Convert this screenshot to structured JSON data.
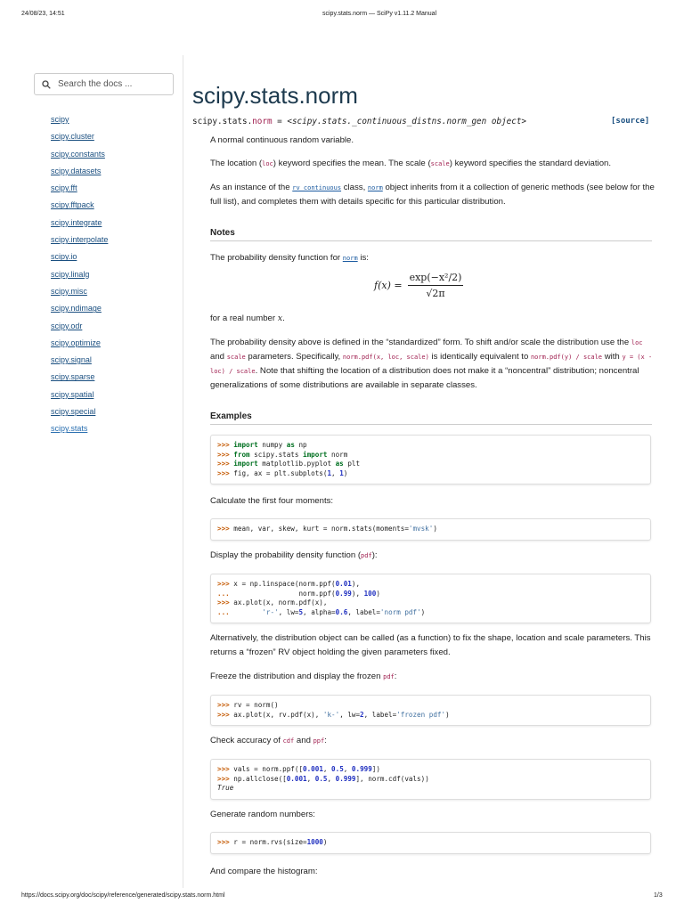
{
  "browser": {
    "datetime": "24/08/23, 14:51",
    "title": "scipy.stats.norm — SciPy v1.11.2 Manual",
    "url": "https://docs.scipy.org/doc/scipy/reference/generated/scipy.stats.norm.html",
    "page": "1/3"
  },
  "search": {
    "placeholder": "Search the docs ..."
  },
  "nav": [
    "scipy",
    "scipy.cluster",
    "scipy.constants",
    "scipy.datasets",
    "scipy.fft",
    "scipy.fftpack",
    "scipy.integrate",
    "scipy.interpolate",
    "scipy.io",
    "scipy.linalg",
    "scipy.misc",
    "scipy.ndimage",
    "scipy.odr",
    "scipy.optimize",
    "scipy.signal",
    "scipy.sparse",
    "scipy.spatial",
    "scipy.special",
    "scipy.stats"
  ],
  "main": {
    "title": "scipy.stats.norm",
    "sig_prefix": "scipy.stats.",
    "sig_name": "norm",
    "sig_eq": " = ",
    "sig_obj": "<scipy.stats._continuous_distns.norm_gen object>",
    "source": "[source]",
    "notes_heading": "Notes",
    "examples_heading": "Examples",
    "formula": {
      "lhs": "f(x) =",
      "num": "exp(−x²/2)",
      "den": "√2π"
    },
    "paras": {
      "p1": [
        [
          "A normal continuous random variable.",
          ""
        ]
      ],
      "p2": [
        [
          "The location (",
          ""
        ],
        [
          "loc",
          "c"
        ],
        [
          ") keyword specifies the mean. The scale (",
          ""
        ],
        [
          "scale",
          "c"
        ],
        [
          ") keyword specifies the standard deviation.",
          ""
        ]
      ],
      "p3": [
        [
          "As an instance of the ",
          ""
        ],
        [
          "rv_continuous",
          "l"
        ],
        [
          " class, ",
          ""
        ],
        [
          "norm",
          "l"
        ],
        [
          " object inherits from it a collection of generic methods (see below for the full list), and completes them with details specific for this particular distribution.",
          ""
        ]
      ],
      "p4": [
        [
          "The probability density function for ",
          ""
        ],
        [
          "norm",
          "l"
        ],
        [
          " is:",
          ""
        ]
      ],
      "p5": [
        [
          "for a real number ",
          ""
        ],
        [
          "x",
          "i"
        ],
        [
          ".",
          ""
        ]
      ],
      "p6": [
        [
          "The probability density above is defined in the “standardized” form. To shift and/or scale the distribution use the ",
          ""
        ],
        [
          "loc",
          "c"
        ],
        [
          " and ",
          ""
        ],
        [
          "scale",
          "c"
        ],
        [
          " parameters. Specifically, ",
          ""
        ],
        [
          "norm.pdf(x, loc, scale)",
          "c"
        ],
        [
          " is identically equivalent to ",
          ""
        ],
        [
          "norm.pdf(y) / scale",
          "c"
        ],
        [
          " with ",
          ""
        ],
        [
          "y = (x - loc) / scale",
          "c"
        ],
        [
          ". Note that shifting the location of a distribution does not make it a “noncentral” distribution; noncentral generalizations of some distributions are available in separate classes.",
          ""
        ]
      ],
      "p7": [
        [
          "Calculate the first four moments:",
          ""
        ]
      ],
      "p8": [
        [
          "Display the probability density function (",
          ""
        ],
        [
          "pdf",
          "c"
        ],
        [
          "):",
          ""
        ]
      ],
      "p9": [
        [
          "Alternatively, the distribution object can be called (as a function) to fix the shape, location and scale parameters. This returns a “frozen” RV object holding the given parameters fixed.",
          ""
        ]
      ],
      "p10": [
        [
          "Freeze the distribution and display the frozen ",
          ""
        ],
        [
          "pdf",
          "c"
        ],
        [
          ":",
          ""
        ]
      ],
      "p11": [
        [
          "Check accuracy of ",
          ""
        ],
        [
          "cdf",
          "c"
        ],
        [
          " and ",
          ""
        ],
        [
          "ppf",
          "c"
        ],
        [
          ":",
          ""
        ]
      ],
      "p12": [
        [
          "Generate random numbers:",
          ""
        ]
      ],
      "p13": [
        [
          "And compare the histogram:",
          ""
        ]
      ]
    },
    "code": {
      "c1": [
        [
          ">>> ",
          "p"
        ],
        [
          "import",
          "k"
        ],
        [
          " numpy ",
          ""
        ],
        [
          "as",
          "k"
        ],
        [
          " np\n",
          ""
        ],
        [
          ">>> ",
          "p"
        ],
        [
          "from",
          "k"
        ],
        [
          " scipy.stats ",
          ""
        ],
        [
          "import",
          "k"
        ],
        [
          " norm\n",
          ""
        ],
        [
          ">>> ",
          "p"
        ],
        [
          "import",
          "k"
        ],
        [
          " matplotlib.pyplot ",
          ""
        ],
        [
          "as",
          "k"
        ],
        [
          " plt\n",
          ""
        ],
        [
          ">>> ",
          "p"
        ],
        [
          "fig, ax = plt.subplots(",
          ""
        ],
        [
          "1",
          "n"
        ],
        [
          ", ",
          ""
        ],
        [
          "1",
          "n"
        ],
        [
          ")",
          ""
        ]
      ],
      "c2": [
        [
          ">>> ",
          "p"
        ],
        [
          "mean, var, skew, kurt = norm.stats(moments=",
          ""
        ],
        [
          "'mvsk'",
          "s"
        ],
        [
          ")",
          ""
        ]
      ],
      "c3": [
        [
          ">>> ",
          "p"
        ],
        [
          "x = np.linspace(norm.ppf(",
          ""
        ],
        [
          "0.01",
          "n"
        ],
        [
          "),\n",
          ""
        ],
        [
          "... ",
          "p"
        ],
        [
          "                norm.ppf(",
          ""
        ],
        [
          "0.99",
          "n"
        ],
        [
          "), ",
          ""
        ],
        [
          "100",
          "n"
        ],
        [
          ")\n",
          ""
        ],
        [
          ">>> ",
          "p"
        ],
        [
          "ax.plot(x, norm.pdf(x),\n",
          ""
        ],
        [
          "... ",
          "p"
        ],
        [
          "       ",
          ""
        ],
        [
          "'r-'",
          "s"
        ],
        [
          ", lw=",
          ""
        ],
        [
          "5",
          "n"
        ],
        [
          ", alpha=",
          ""
        ],
        [
          "0.6",
          "n"
        ],
        [
          ", label=",
          ""
        ],
        [
          "'norm pdf'",
          "s"
        ],
        [
          ")",
          ""
        ]
      ],
      "c4": [
        [
          ">>> ",
          "p"
        ],
        [
          "rv = norm()\n",
          ""
        ],
        [
          ">>> ",
          "p"
        ],
        [
          "ax.plot(x, rv.pdf(x), ",
          ""
        ],
        [
          "'k-'",
          "s"
        ],
        [
          ", lw=",
          ""
        ],
        [
          "2",
          "n"
        ],
        [
          ", label=",
          ""
        ],
        [
          "'frozen pdf'",
          "s"
        ],
        [
          ")",
          ""
        ]
      ],
      "c5": [
        [
          ">>> ",
          "p"
        ],
        [
          "vals = norm.ppf([",
          ""
        ],
        [
          "0.001",
          "n"
        ],
        [
          ", ",
          ""
        ],
        [
          "0.5",
          "n"
        ],
        [
          ", ",
          ""
        ],
        [
          "0.999",
          "n"
        ],
        [
          "])\n",
          ""
        ],
        [
          ">>> ",
          "p"
        ],
        [
          "np.allclose([",
          ""
        ],
        [
          "0.001",
          "n"
        ],
        [
          ", ",
          ""
        ],
        [
          "0.5",
          "n"
        ],
        [
          ", ",
          ""
        ],
        [
          "0.999",
          "n"
        ],
        [
          "], norm.cdf(vals))\n",
          ""
        ],
        [
          "True",
          "i"
        ]
      ],
      "c6": [
        [
          ">>> ",
          "p"
        ],
        [
          "r = norm.rvs(size=",
          ""
        ],
        [
          "1000",
          "n"
        ],
        [
          ")",
          ""
        ]
      ]
    }
  }
}
